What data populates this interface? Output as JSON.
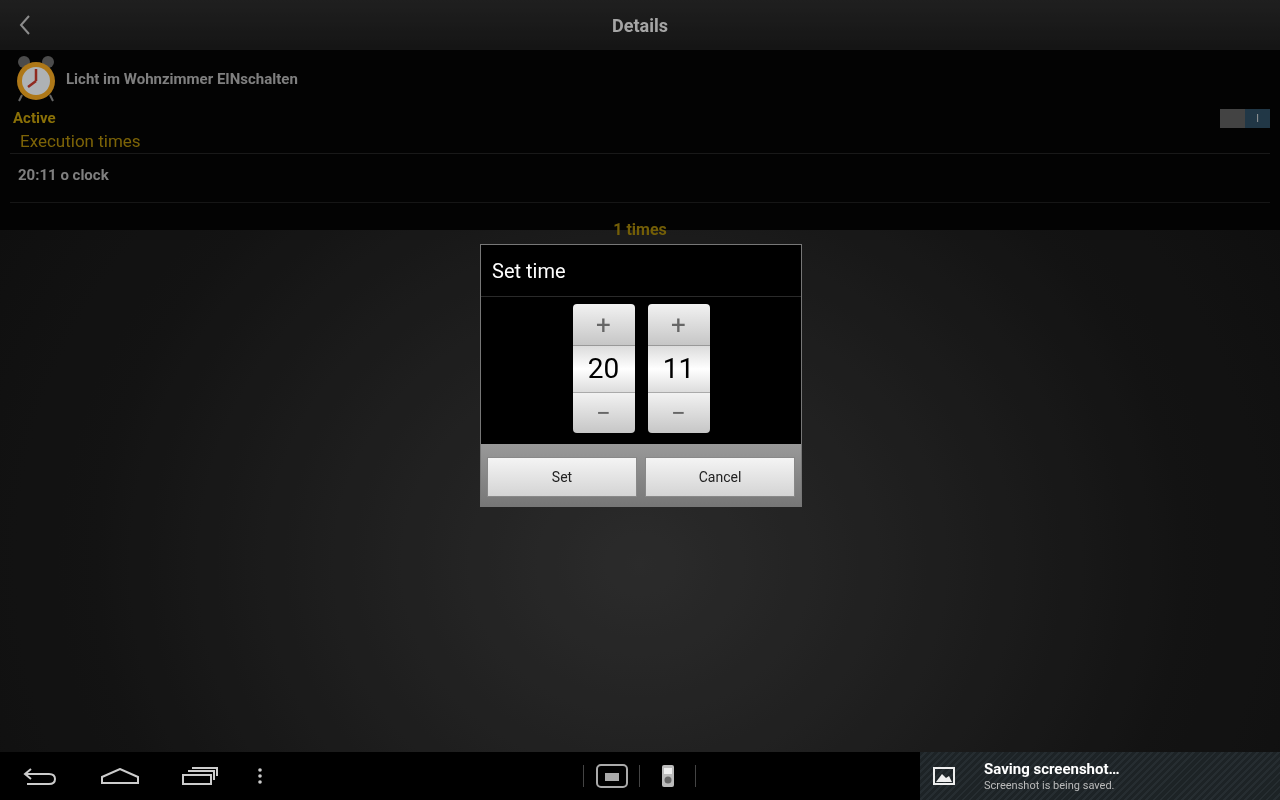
{
  "action_bar": {
    "title": "Details"
  },
  "task": {
    "name": "Licht im Wohnzimmer EINschalten"
  },
  "active": {
    "label": "Active",
    "on": true,
    "switch_text": "I"
  },
  "execution_times": {
    "heading": "Execution times",
    "items": [
      "20:11 o clock"
    ],
    "count": "1 times"
  },
  "dialog": {
    "title": "Set time",
    "pickers": [
      {
        "value": "20",
        "increment": "+",
        "decrement": "−"
      },
      {
        "value": "11",
        "increment": "+",
        "decrement": "−"
      }
    ],
    "buttons": [
      "Set",
      "Cancel"
    ]
  },
  "notification": {
    "title": "Saving screenshot…",
    "text": "Screenshot is being saved."
  }
}
